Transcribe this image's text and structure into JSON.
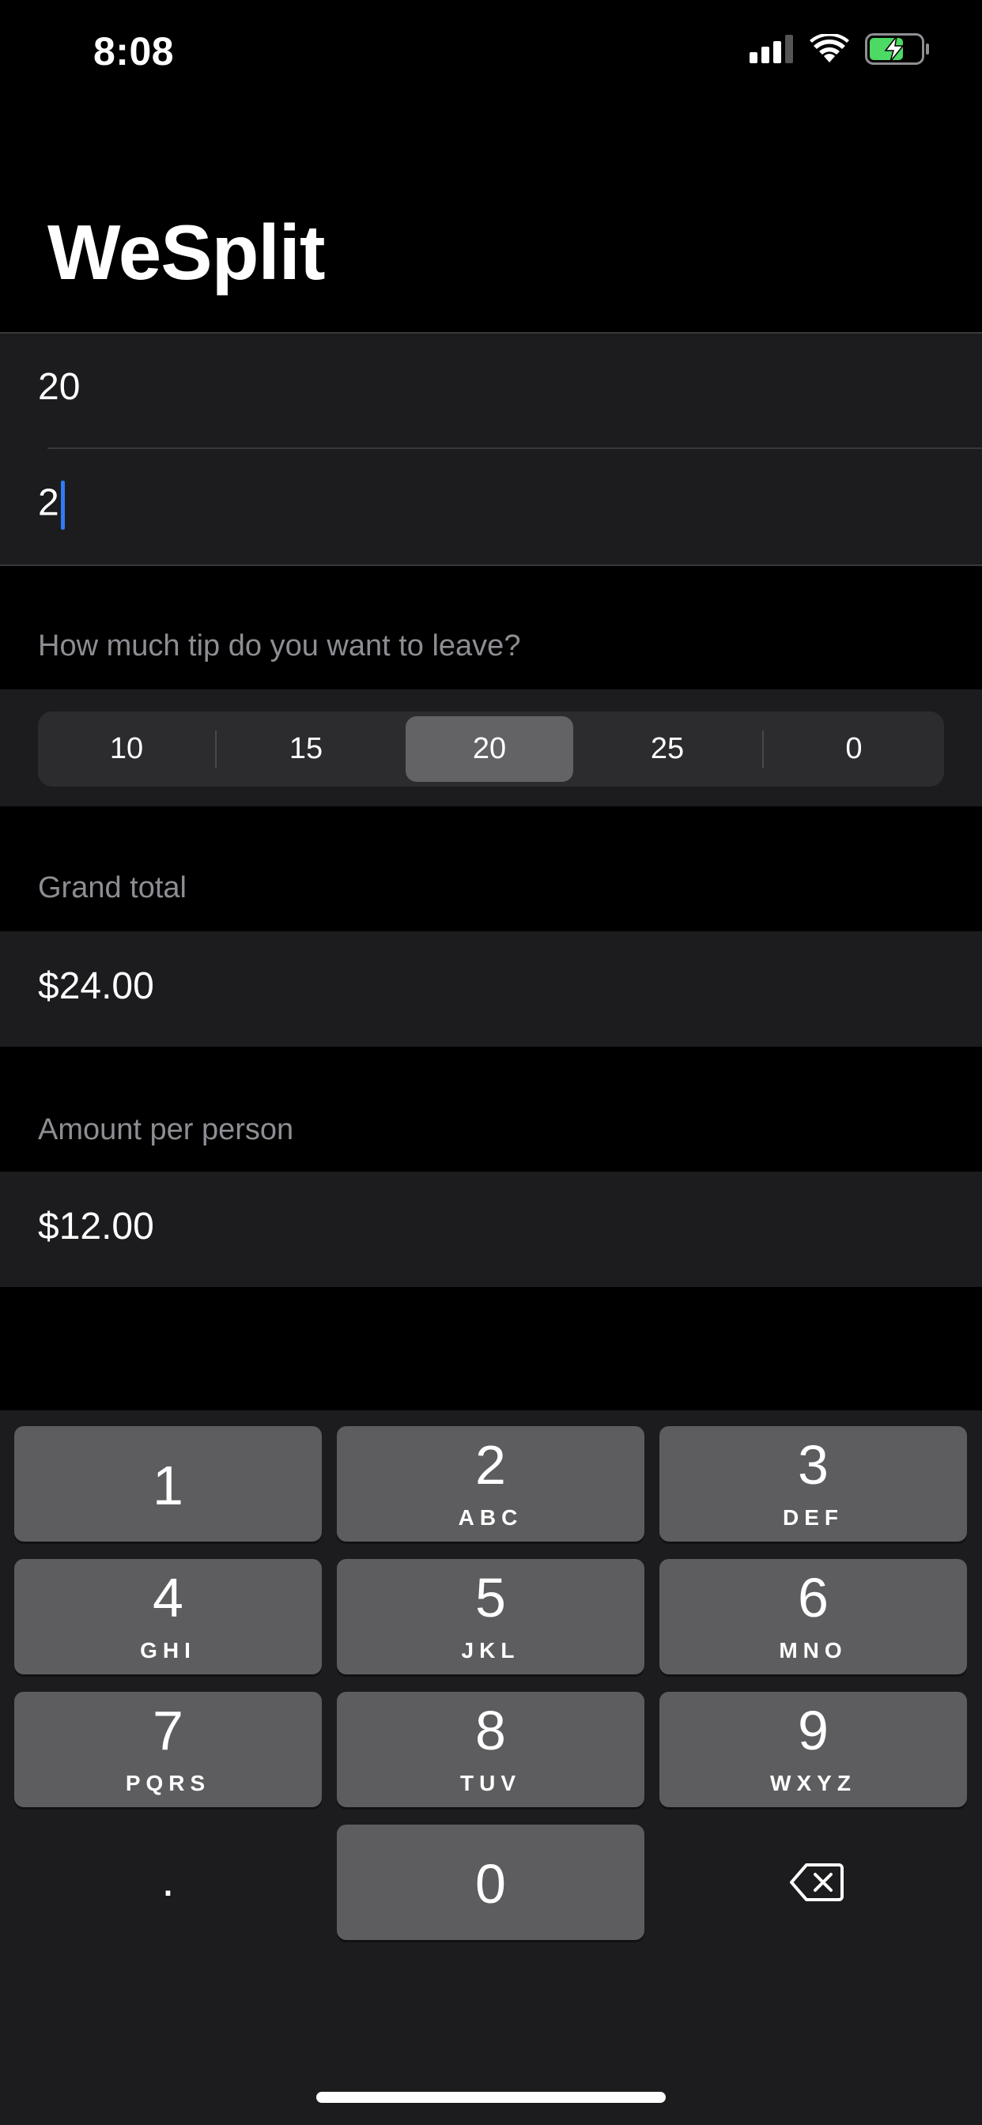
{
  "status_bar": {
    "time": "8:08"
  },
  "nav": {
    "title": "WeSplit"
  },
  "inputs": {
    "check_amount": "20",
    "number_of_people": "2"
  },
  "tip_section": {
    "header": "How much tip do you want to leave?",
    "options": [
      "10",
      "15",
      "20",
      "25",
      "0"
    ],
    "selected": "20"
  },
  "grand_total": {
    "header": "Grand total",
    "value": "$24.00"
  },
  "per_person": {
    "header": "Amount per person",
    "value": "$12.00"
  },
  "keyboard": {
    "keys": [
      {
        "num": "1",
        "letters": ""
      },
      {
        "num": "2",
        "letters": "ABC"
      },
      {
        "num": "3",
        "letters": "DEF"
      },
      {
        "num": "4",
        "letters": "GHI"
      },
      {
        "num": "5",
        "letters": "JKL"
      },
      {
        "num": "6",
        "letters": "MNO"
      },
      {
        "num": "7",
        "letters": "PQRS"
      },
      {
        "num": "8",
        "letters": "TUV"
      },
      {
        "num": "9",
        "letters": "WXYZ"
      },
      {
        "num": "0",
        "letters": ""
      }
    ],
    "decimal": ".",
    "delete_icon": "delete-backward-icon"
  },
  "colors": {
    "accent_caret": "#2f7bf6",
    "battery_fill": "#4cd964"
  }
}
